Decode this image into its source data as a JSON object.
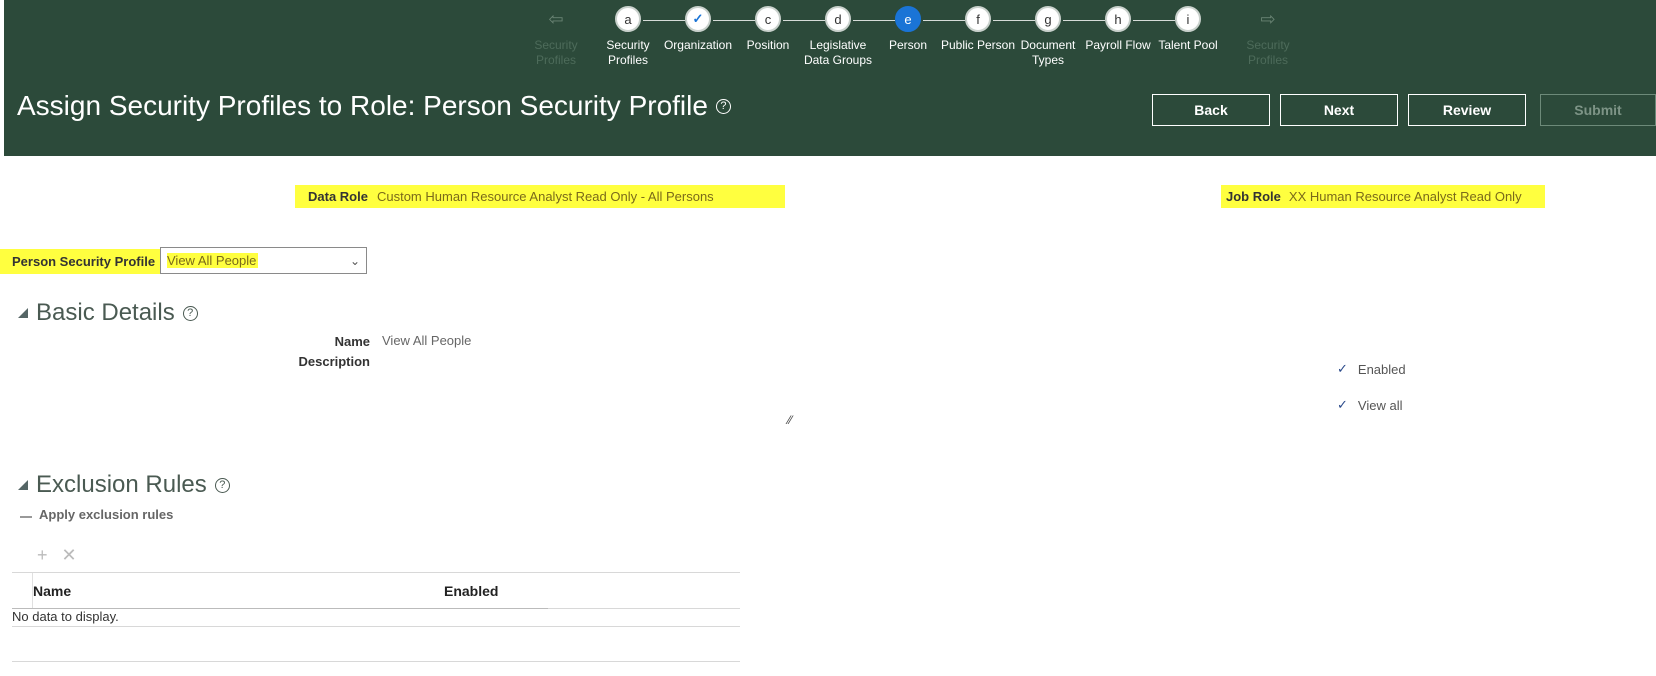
{
  "train": {
    "prev": {
      "label": "Security\nProfiles"
    },
    "next": {
      "label": "Security\nProfiles"
    },
    "stops": [
      {
        "letter": "a",
        "label": "Security\nProfiles"
      },
      {
        "letter": "✓",
        "label": "Organization"
      },
      {
        "letter": "c",
        "label": "Position"
      },
      {
        "letter": "d",
        "label": "Legislative\nData Groups"
      },
      {
        "letter": "e",
        "label": "Person"
      },
      {
        "letter": "f",
        "label": "Public Person"
      },
      {
        "letter": "g",
        "label": "Document\nTypes"
      },
      {
        "letter": "h",
        "label": "Payroll Flow"
      },
      {
        "letter": "i",
        "label": "Talent Pool"
      }
    ]
  },
  "header": {
    "title": "Assign Security Profiles to Role: Person Security Profile",
    "help_icon": "?",
    "buttons": {
      "back": "Back",
      "next": "Next",
      "review": "Review",
      "submit": "Submit"
    }
  },
  "roles": {
    "data_role_label": "Data Role",
    "data_role_value": "Custom Human Resource Analyst Read Only - All Persons",
    "job_role_label": "Job Role",
    "job_role_value": "XX Human Resource Analyst Read Only"
  },
  "profile": {
    "label": "Person Security Profile",
    "value": "View All People"
  },
  "basic": {
    "title": "Basic Details",
    "name_label": "Name",
    "name_value": "View All People",
    "description_label": "Description",
    "enabled": "Enabled",
    "view_all": "View all"
  },
  "exclusion": {
    "title": "Exclusion Rules",
    "apply_label": "Apply exclusion rules",
    "table_headers": [
      "Name",
      "Enabled"
    ],
    "empty_text": "No data to display."
  },
  "colors": {
    "header_bg": "#2c4a3a",
    "highlight": "#ffff3f",
    "current_stop": "#1a74d6"
  },
  "icons": {
    "add": "plus-icon",
    "delete": "x-icon",
    "help": "help-icon",
    "dropdown": "chevron-down-icon"
  }
}
